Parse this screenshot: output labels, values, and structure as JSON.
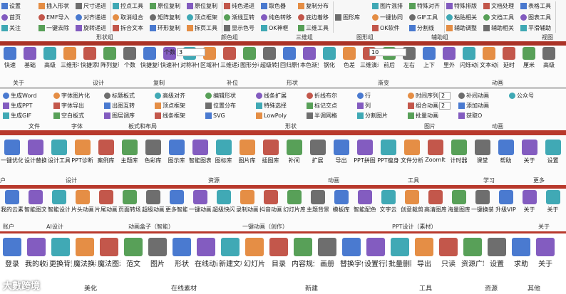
{
  "strip1": {
    "cols": [
      [
        "设置",
        "首页",
        "关注"
      ],
      [
        "插入形状",
        "EMF导入",
        "一键去除"
      ],
      [
        "尺寸递进",
        "对齐递进",
        "旋转递进"
      ],
      [
        "控点工具",
        "取消组合",
        "拆合文本"
      ],
      [
        "原位复制",
        "矩阵复制",
        "环形复制"
      ],
      [
        "原位复制",
        "顶点框架",
        "拆页工具"
      ],
      [
        "纯色递进",
        "渐线互转",
        "显示色号"
      ],
      [
        "取色器",
        "纯色转移",
        "OK神框"
      ],
      [
        "复制分布",
        "底边着移",
        "三维工具"
      ],
      [
        "图形库"
      ],
      [
        "图片混排",
        "一键协同",
        "OK软件"
      ],
      [
        "特殊对齐",
        "GIF工具",
        "分割线"
      ],
      [
        "特殊排版",
        "粘贴相关",
        "辅助调整"
      ],
      [
        "文档处理",
        "文档工具",
        "辅助相关"
      ],
      [
        "表格工具",
        "图表工具",
        "平滑辅助"
      ]
    ],
    "groups": [
      "形状组",
      "颜色组",
      "三维组",
      "图形组",
      "辅助组",
      "视图"
    ]
  },
  "strip2": {
    "buttons": [
      "快速",
      "基础",
      "高级",
      "三维形状",
      "快捷添加",
      "阵列复制",
      "个数",
      "快捷复制",
      "快速补位",
      "对称补位",
      "区域补位",
      "三维递进",
      "图形分布",
      "超级转换",
      "回归原位",
      "本色渐变",
      "钢化",
      "色差",
      "三维演示",
      "前后",
      "左右",
      "上下",
      "里外",
      "闪烁动画",
      "文本动画",
      "延时",
      "厘米",
      "高级"
    ],
    "count_value": "3",
    "color_value": "10",
    "groups": [
      "关于",
      "设计",
      "复制",
      "补位",
      "形状",
      "渐变",
      "动画"
    ]
  },
  "strip3": {
    "items": [
      "生成Word",
      "生成PPT",
      "生成GIF",
      "字体图片化",
      "字体导出",
      "空白板式",
      "标题板式",
      "出图互转",
      "图层调序",
      "高级对齐",
      "顶点框架",
      "线条框架",
      "编辑形状",
      "位置分布",
      "SVG",
      "线条扩展",
      "特殊选择",
      "LowPoly",
      "折线布尔",
      "标记交点",
      "半调网格",
      "行",
      "列",
      "分割图片",
      "时间序列",
      "组合动画",
      "批量动画",
      "补间动画",
      "添加动画",
      "获取O",
      "公众号"
    ],
    "row_value": "2",
    "col_value": "2",
    "groups": [
      "文件",
      "字体",
      "板式和布局",
      "形状",
      "图片",
      "动画"
    ]
  },
  "strip4": {
    "buttons": [
      "一键优化",
      "设计替换",
      "设计工具",
      "PPT诊断",
      "案例库",
      "主题库",
      "色彩库",
      "图示库",
      "智能图表",
      "图标库",
      "图片库",
      "插图库",
      "补间",
      "扩展",
      "导出",
      "PPT拼图",
      "PPT瘦身",
      "文件分析",
      "ZoomIt",
      "计时器",
      "课堂",
      "帮助",
      "关于",
      "设置"
    ],
    "groups": [
      "户",
      "设计",
      "资源",
      "动画",
      "工具",
      "学习",
      "更多"
    ]
  },
  "strip5": {
    "buttons": [
      "我的云素材",
      "智能图文",
      "智能设计",
      "片头动画",
      "片尾动画",
      "页面转场",
      "超级动画",
      "更多智能动画",
      "一键动画",
      "超级快闪",
      "录制动画",
      "抖音动画",
      "幻灯片库",
      "主题背景",
      "模板库",
      "智能配色",
      "文字云",
      "创意裁剪",
      "高清图库",
      "海量图库",
      "一键换装",
      "升级VIP",
      "关于",
      "关于"
    ],
    "groups": [
      "账户",
      "AI设计",
      "动画盒子（智能）",
      "一键动画（创作）",
      "PPT设计（素材）",
      "关于"
    ]
  },
  "strip6": {
    "buttons": [
      "登录",
      "我的收藏",
      "更换背景",
      "魔法换装",
      "魔法图示",
      "范文",
      "图片",
      "形状",
      "在线动画",
      "新建文档",
      "幻灯片",
      "目录",
      "内容规划",
      "画册",
      "替换字体",
      "设置行距",
      "批量删除",
      "导出",
      "只读",
      "资源广场",
      "设置",
      "求助",
      "关于"
    ],
    "groups": [
      "美化",
      "在线素材",
      "新建",
      "工具",
      "资源",
      "其他"
    ],
    "watermark": "大數跨境"
  },
  "colors": {
    "accent_red": "#b8392c",
    "blue": "#2a63c8",
    "purple": "#6d3fb5",
    "teal": "#1f9aa8",
    "orange": "#e07a24"
  }
}
